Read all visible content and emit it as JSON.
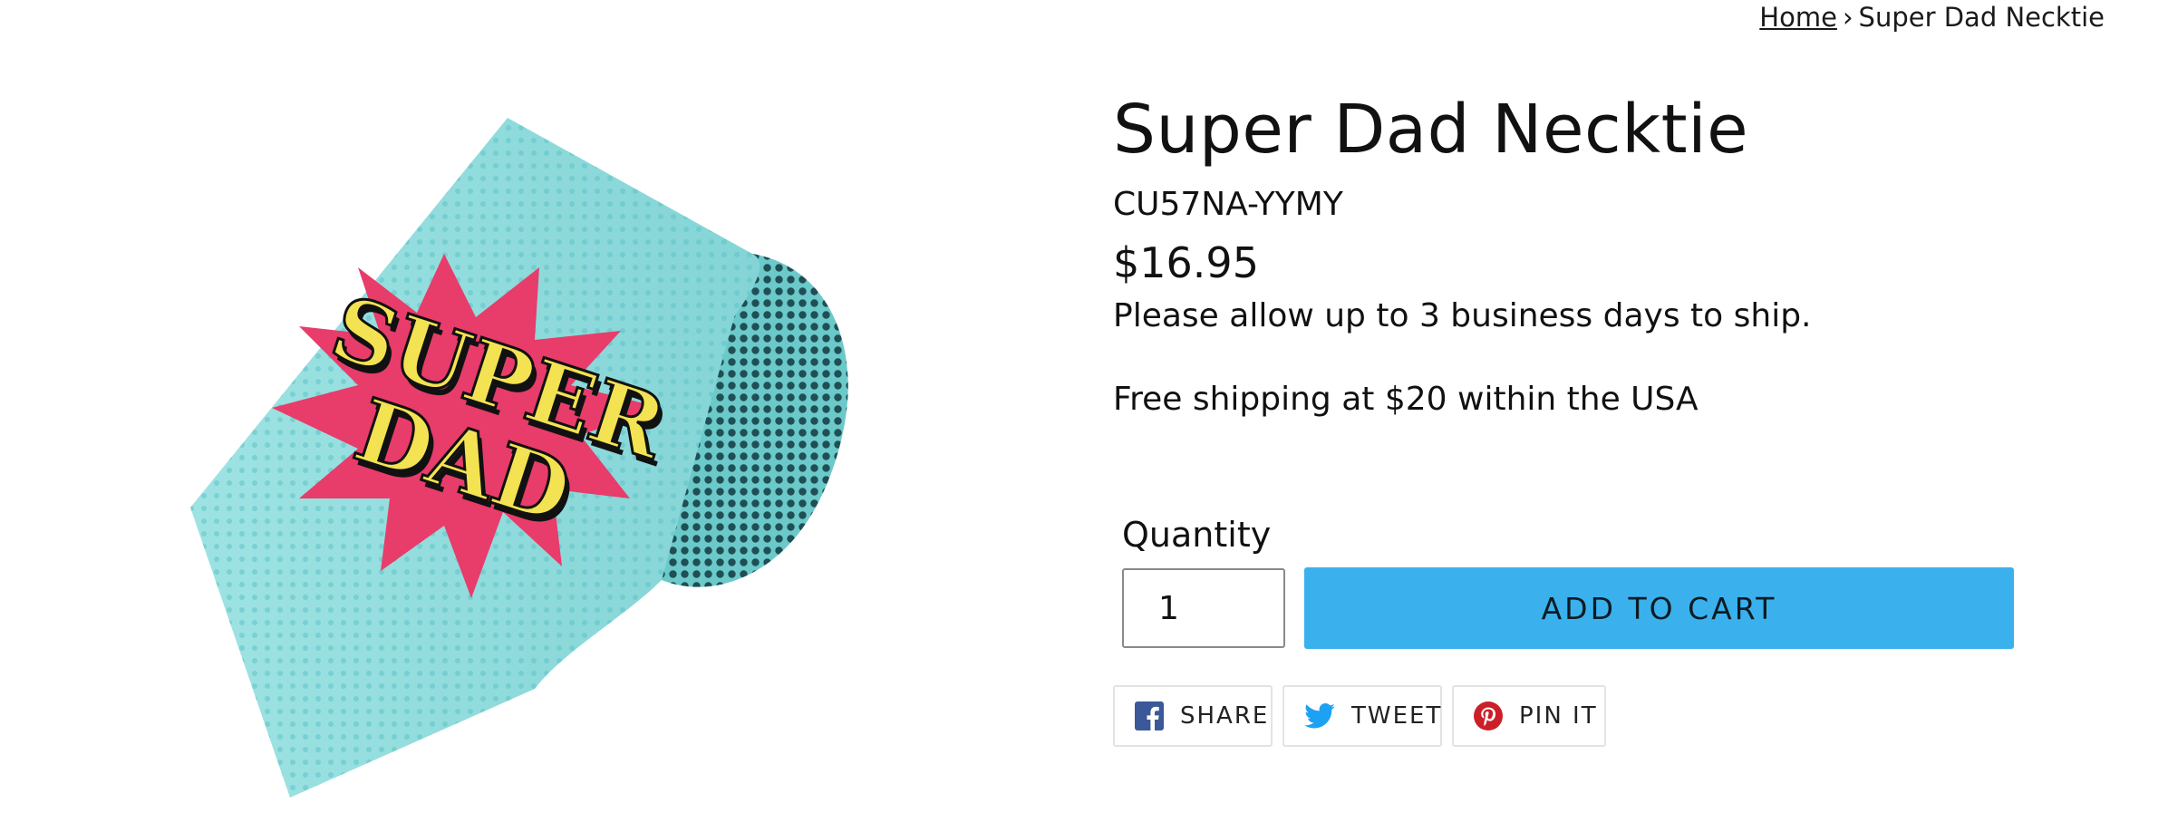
{
  "breadcrumb": {
    "home": "Home",
    "separator": "›",
    "current": "Super Dad Necktie"
  },
  "product": {
    "image_text_line1": "SUPER",
    "image_text_line2": "DAD",
    "title": "Super Dad Necktie",
    "sku": "CU57NA-YYMY",
    "price": "$16.95",
    "ship_note": "Please allow up to 3 business days to ship.",
    "free_shipping": "Free shipping at $20 within the USA"
  },
  "form": {
    "quantity_label": "Quantity",
    "quantity_value": "1",
    "add_to_cart": "ADD TO CART"
  },
  "share": {
    "facebook": {
      "label": "SHARE",
      "icon": "facebook-icon",
      "color": "#3b5998"
    },
    "twitter": {
      "label": "TWEET",
      "icon": "twitter-icon",
      "color": "#1da1f2"
    },
    "pinterest": {
      "label": "PIN IT",
      "icon": "pinterest-icon",
      "color": "#cb2027"
    }
  },
  "colors": {
    "accent": "#3ab1ec",
    "tie_base": "#8fdcdc",
    "tie_shadow": "#2f7f84",
    "burst": "#e83c6a",
    "tie_text": "#f3e352"
  }
}
